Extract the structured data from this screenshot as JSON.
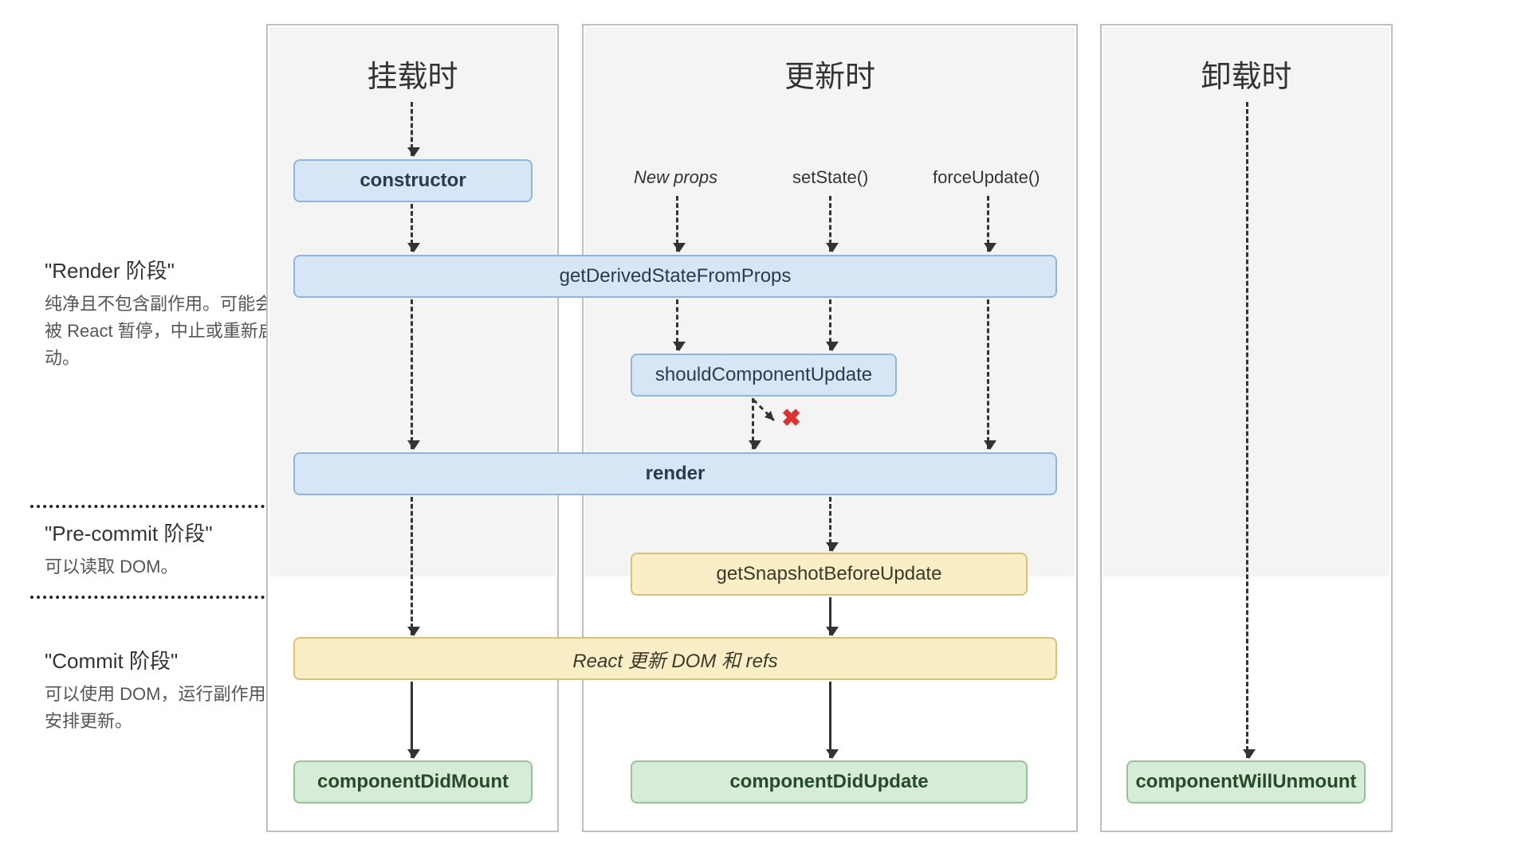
{
  "columns": {
    "mount": {
      "title": "挂载时"
    },
    "update": {
      "title": "更新时"
    },
    "unmount": {
      "title": "卸载时"
    }
  },
  "side": {
    "render": {
      "title": "\"Render 阶段\"",
      "desc": "纯净且不包含副作用。可能会被 React 暂停，中止或重新启动。"
    },
    "precommit": {
      "title": "\"Pre-commit 阶段\"",
      "desc": "可以读取 DOM。"
    },
    "commit": {
      "title": "\"Commit 阶段\"",
      "desc": "可以使用 DOM，运行副作用，安排更新。"
    }
  },
  "triggers": {
    "newProps": "New props",
    "setState": "setState()",
    "forceUpdate": "forceUpdate()"
  },
  "nodes": {
    "constructor": "constructor",
    "gdsfp": "getDerivedStateFromProps",
    "scu": "shouldComponentUpdate",
    "render": "render",
    "gsbU": "getSnapshotBeforeUpdate",
    "updateDom": "React 更新 DOM 和 refs",
    "didMount": "componentDidMount",
    "didUpdate": "componentDidUpdate",
    "willUnmount": "componentWillUnmount"
  },
  "marks": {
    "cancel": "✖"
  },
  "colors": {
    "blue": "#d6e6f5",
    "yellow": "#faeec7",
    "green": "#d6ecd7",
    "shade": "#f4f4f4",
    "border": "#bdbfc2"
  }
}
